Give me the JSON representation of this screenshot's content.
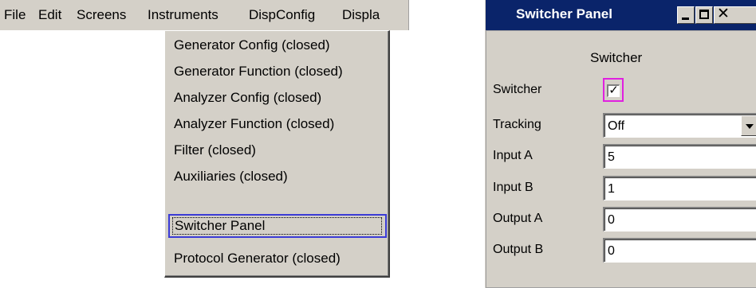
{
  "menubar": {
    "items": [
      "File",
      "Edit",
      "Screens",
      "Instruments",
      "DispConfig",
      "Displa"
    ]
  },
  "dropdown": {
    "items": [
      "Generator Config (closed)",
      "Generator Function (closed)",
      "Analyzer Config (closed)",
      "Analyzer Function (closed)",
      "Filter (closed)",
      "Auxiliaries (closed)",
      "Switcher Panel",
      "Protocol Generator (closed)"
    ],
    "selected_index": 6
  },
  "panel": {
    "title": "Switcher Panel",
    "section": "Switcher",
    "rows": [
      {
        "label": "Switcher",
        "checked": true
      },
      {
        "label": "Tracking",
        "value": "Off"
      },
      {
        "label": "Input A",
        "value": "5"
      },
      {
        "label": "Input B",
        "value": "1"
      },
      {
        "label": "Output A",
        "value": "0"
      },
      {
        "label": "Output B",
        "value": "0"
      }
    ],
    "checkmark": "✓",
    "minimize_glyph": "",
    "maximize_glyph": "",
    "close_glyph": "✕"
  },
  "colors": {
    "face": "#d4d0c8",
    "title_bar": "#0a246a",
    "selected_border": "#3b3bd6",
    "checkbox_focus": "#e020e0"
  }
}
